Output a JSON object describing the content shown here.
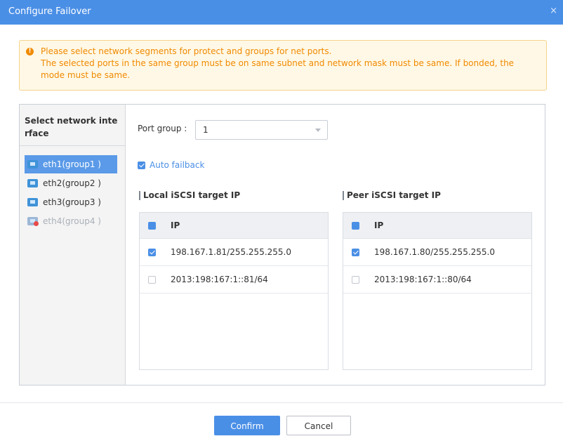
{
  "dialog": {
    "title": "Configure Failover",
    "close_glyph": "×"
  },
  "notice": {
    "icon": "!",
    "line1": "Please select network segments for protect and groups for net ports.",
    "line2": "The selected ports in the same group must be on same subnet and network mask must be same. If bonded, the",
    "line3": "mode must be same."
  },
  "interfaces": {
    "header_line1": "Select network inte",
    "header_line2": "rface",
    "items": [
      {
        "label": "eth1(group1 )",
        "selected": true,
        "disabled": false
      },
      {
        "label": "eth2(group2 )",
        "selected": false,
        "disabled": false
      },
      {
        "label": "eth3(group3 )",
        "selected": false,
        "disabled": false
      },
      {
        "label": "eth4(group4 )",
        "selected": false,
        "disabled": true
      }
    ]
  },
  "port_group": {
    "label": "Port group :",
    "value": "1"
  },
  "auto_failback": {
    "label": "Auto failback",
    "checked": true
  },
  "local": {
    "title": "Local iSCSI target IP",
    "column": "IP",
    "rows": [
      {
        "ip": "198.167.1.81/255.255.255.0",
        "checked": true
      },
      {
        "ip": "2013:198:167:1::81/64",
        "checked": false
      }
    ]
  },
  "peer": {
    "title": "Peer iSCSI target IP",
    "column": "IP",
    "rows": [
      {
        "ip": "198.167.1.80/255.255.255.0",
        "checked": true
      },
      {
        "ip": "2013:198:167:1::80/64",
        "checked": false
      }
    ]
  },
  "buttons": {
    "confirm": "Confirm",
    "cancel": "Cancel"
  },
  "colors": {
    "accent": "#4a8fe6",
    "warning": "#f08a00",
    "warning_bg": "#fff8e6"
  }
}
